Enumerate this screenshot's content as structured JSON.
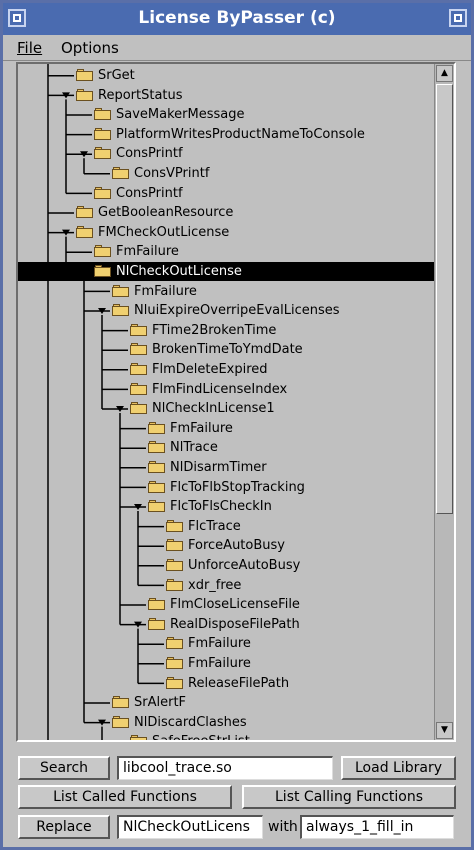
{
  "window": {
    "title": "License ByPasser (c)"
  },
  "menu": {
    "file": "File",
    "options": "Options"
  },
  "tree": [
    {
      "label": "SrGet",
      "depth": 1
    },
    {
      "label": "ReportStatus",
      "depth": 1
    },
    {
      "label": "SaveMakerMessage",
      "depth": 2
    },
    {
      "label": "PlatformWritesProductNameToConsole",
      "depth": 2
    },
    {
      "label": "ConsPrintf",
      "depth": 2
    },
    {
      "label": "ConsVPrintf",
      "depth": 3
    },
    {
      "label": "ConsPrintf",
      "depth": 2
    },
    {
      "label": "GetBooleanResource",
      "depth": 1
    },
    {
      "label": "FMCheckOutLicense",
      "depth": 1
    },
    {
      "label": "FmFailure",
      "depth": 2
    },
    {
      "label": "NlCheckOutLicense",
      "depth": 2,
      "selected": true
    },
    {
      "label": "FmFailure",
      "depth": 3
    },
    {
      "label": "NluiExpireOverripeEvalLicenses",
      "depth": 3
    },
    {
      "label": "FTime2BrokenTime",
      "depth": 4
    },
    {
      "label": "BrokenTimeToYmdDate",
      "depth": 4
    },
    {
      "label": "FlmDeleteExpired",
      "depth": 4
    },
    {
      "label": "FlmFindLicenseIndex",
      "depth": 4
    },
    {
      "label": "NlCheckInLicense1",
      "depth": 4
    },
    {
      "label": "FmFailure",
      "depth": 5
    },
    {
      "label": "NlTrace",
      "depth": 5
    },
    {
      "label": "NlDisarmTimer",
      "depth": 5
    },
    {
      "label": "FlcToFlbStopTracking",
      "depth": 5
    },
    {
      "label": "FlcToFlsCheckIn",
      "depth": 5
    },
    {
      "label": "FlcTrace",
      "depth": 6
    },
    {
      "label": "ForceAutoBusy",
      "depth": 6
    },
    {
      "label": "UnforceAutoBusy",
      "depth": 6
    },
    {
      "label": "xdr_free",
      "depth": 6
    },
    {
      "label": "FlmCloseLicenseFile",
      "depth": 5
    },
    {
      "label": "RealDisposeFilePath",
      "depth": 5
    },
    {
      "label": "FmFailure",
      "depth": 6
    },
    {
      "label": "FmFailure",
      "depth": 6
    },
    {
      "label": "ReleaseFilePath",
      "depth": 6
    },
    {
      "label": "SrAlertF",
      "depth": 3
    },
    {
      "label": "NlDiscardClashes",
      "depth": 3
    },
    {
      "label": "SafeFreeStrList",
      "depth": 4
    }
  ],
  "controls": {
    "search_label": "Search",
    "search_value": "libcool_trace.so",
    "load_library_label": "Load Library",
    "list_called_label": "List Called Functions",
    "list_calling_label": "List Calling Functions",
    "replace_label": "Replace",
    "replace_value": "NlCheckOutLicens",
    "with_label": "with",
    "with_value": "always_1_fill_in"
  },
  "colors": {
    "titlebar": "#4a6bb0",
    "selection": "#000000",
    "folder": "#f0d070",
    "tree_line": "#000000"
  },
  "icons": {
    "folder": "folder-icon",
    "expander": "triangle-expander-icon",
    "scroll_up": "arrow-up-icon",
    "scroll_down": "arrow-down-icon"
  }
}
